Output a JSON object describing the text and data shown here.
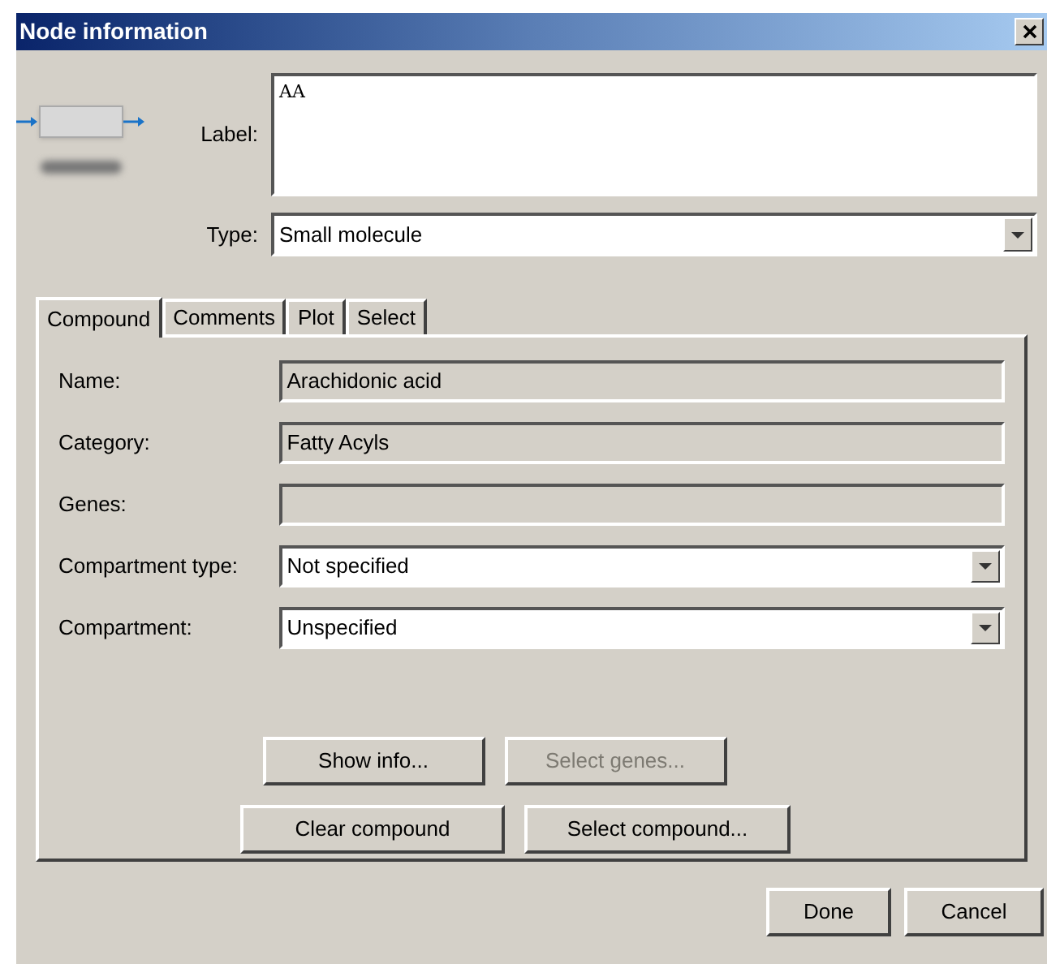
{
  "window": {
    "title": "Node information"
  },
  "label": {
    "caption": "Label:",
    "value": "AA"
  },
  "type": {
    "caption": "Type:",
    "value": "Small molecule"
  },
  "tabs": [
    {
      "label": "Compound",
      "selected": true
    },
    {
      "label": "Comments",
      "selected": false
    },
    {
      "label": "Plot",
      "selected": false
    },
    {
      "label": "Select",
      "selected": false
    }
  ],
  "fields": [
    {
      "kind": "text",
      "label": "Name:",
      "value": "Arachidonic acid"
    },
    {
      "kind": "text",
      "label": "Category:",
      "value": "Fatty Acyls"
    },
    {
      "kind": "text",
      "label": "Genes:"
    },
    {
      "kind": "dropdown",
      "label": "Compartment type:",
      "value": "Not specified"
    },
    {
      "kind": "dropdown",
      "label": "Compartment:",
      "value": "Unspecified"
    }
  ],
  "panel_buttons": [
    [
      {
        "label": "Show info...",
        "disabled": false
      },
      {
        "label": "Select genes...",
        "disabled": true
      }
    ],
    [
      {
        "label": "Clear compound",
        "disabled": false
      },
      {
        "label": "Select compound...",
        "disabled": false
      }
    ]
  ],
  "buttons": [
    "Done",
    "Cancel"
  ]
}
